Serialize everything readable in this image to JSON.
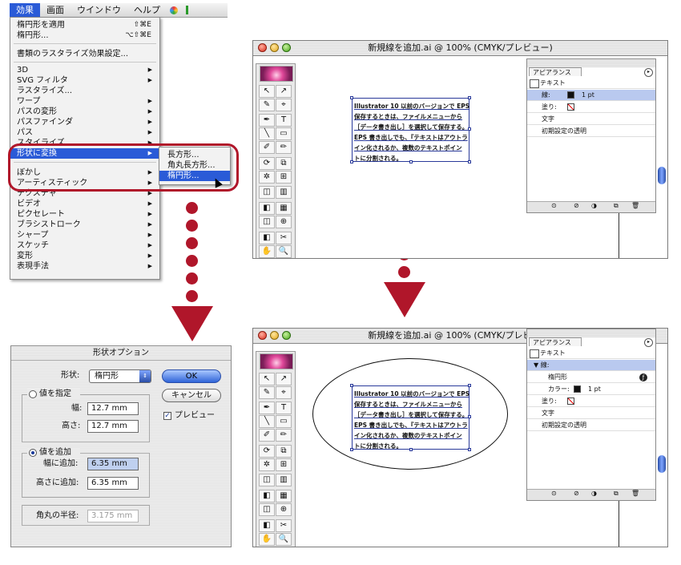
{
  "menubar": {
    "items": [
      "効果",
      "画面",
      "ウインドウ",
      "ヘルプ"
    ]
  },
  "effect_menu": {
    "items": [
      {
        "label": "楕円形を適用",
        "shortcut": "⇧⌘E"
      },
      {
        "label": "楕円形...",
        "shortcut": "⌥⇧⌘E"
      },
      {
        "label": "書類のラスタライズ効果設定..."
      },
      {
        "label": "3D"
      },
      {
        "label": "SVG フィルタ"
      },
      {
        "label": "ラスタライズ..."
      },
      {
        "label": "ワープ"
      },
      {
        "label": "パスの変形"
      },
      {
        "label": "パスファインダ"
      },
      {
        "label": "パス"
      },
      {
        "label": "スタイライズ"
      },
      {
        "label": "形状に変換"
      },
      {
        "label": "ぼかし"
      },
      {
        "label": "アーティスティック"
      },
      {
        "label": "テクスチャ"
      },
      {
        "label": "ビデオ"
      },
      {
        "label": "ピクセレート"
      },
      {
        "label": "ブラシストローク"
      },
      {
        "label": "シャープ"
      },
      {
        "label": "スケッチ"
      },
      {
        "label": "変形"
      },
      {
        "label": "表現手法"
      }
    ],
    "arrow": "▶"
  },
  "shape_submenu": {
    "items": [
      "長方形...",
      "角丸長方形...",
      "楕円形..."
    ]
  },
  "window": {
    "title": "新規線を追加.ai @ 100% (CMYK/プレビュー)"
  },
  "tools": {
    "glyphs": [
      "↖",
      "↗",
      "✎",
      "⌖",
      "✒",
      "T",
      "╲",
      "▭",
      "✐",
      "✏",
      "⟳",
      "⧉",
      "✲",
      "⊞",
      "◫",
      "▥",
      "◧",
      "▦",
      "✂",
      "⊕",
      "✋",
      "🔍"
    ]
  },
  "text_block": {
    "lines": [
      "Illustrator 10 以前のバージョンで EPS",
      "保存するときは、ファイルメニューから",
      "［データ書き出し］を選択して保存する。",
      "EPS 書き出しでも、『テキストはアウトラ",
      "イン化されるか、複数のテキストポイン",
      "トに分割される。"
    ]
  },
  "appearance_panel_top": {
    "tab": "アピアランス",
    "header": "テキスト",
    "rows": [
      {
        "label": "線:",
        "value": "1 pt"
      },
      {
        "label": "塗り:"
      },
      {
        "label": "文字"
      },
      {
        "label": "初期設定の透明"
      }
    ]
  },
  "appearance_panel_bottom": {
    "tab": "アピアランス",
    "header": "テキスト",
    "rows": [
      {
        "label": "▼ 線:"
      },
      {
        "label": "楕円形"
      },
      {
        "label": "カラー:",
        "value": "1 pt"
      },
      {
        "label": "塗り:"
      },
      {
        "label": "文字"
      },
      {
        "label": "初期設定の透明"
      }
    ],
    "fx_badge": "ƒ"
  },
  "panel_footer_icons": [
    "⊙",
    "⊘",
    "◑",
    "⧉",
    "🗑"
  ],
  "dialog": {
    "title": "形状オプション",
    "shape_label": "形状:",
    "shape_value": "楕円形",
    "ok": "OK",
    "cancel": "キャンセル",
    "preview": "プレビュー",
    "preview_checked": true,
    "specify": {
      "label": "値を指定",
      "width_label": "幅:",
      "width_value": "12.7 mm",
      "height_label": "高さ:",
      "height_value": "12.7 mm"
    },
    "add": {
      "label": "値を追加",
      "width_label": "幅に追加:",
      "width_value": "6.35 mm",
      "height_label": "高さに追加:",
      "height_value": "6.35 mm"
    },
    "corner_label": "角丸の半径:",
    "corner_value": "3.175 mm"
  },
  "colors": {
    "accent": "#b0162a",
    "selection": "#2a5bd7"
  }
}
